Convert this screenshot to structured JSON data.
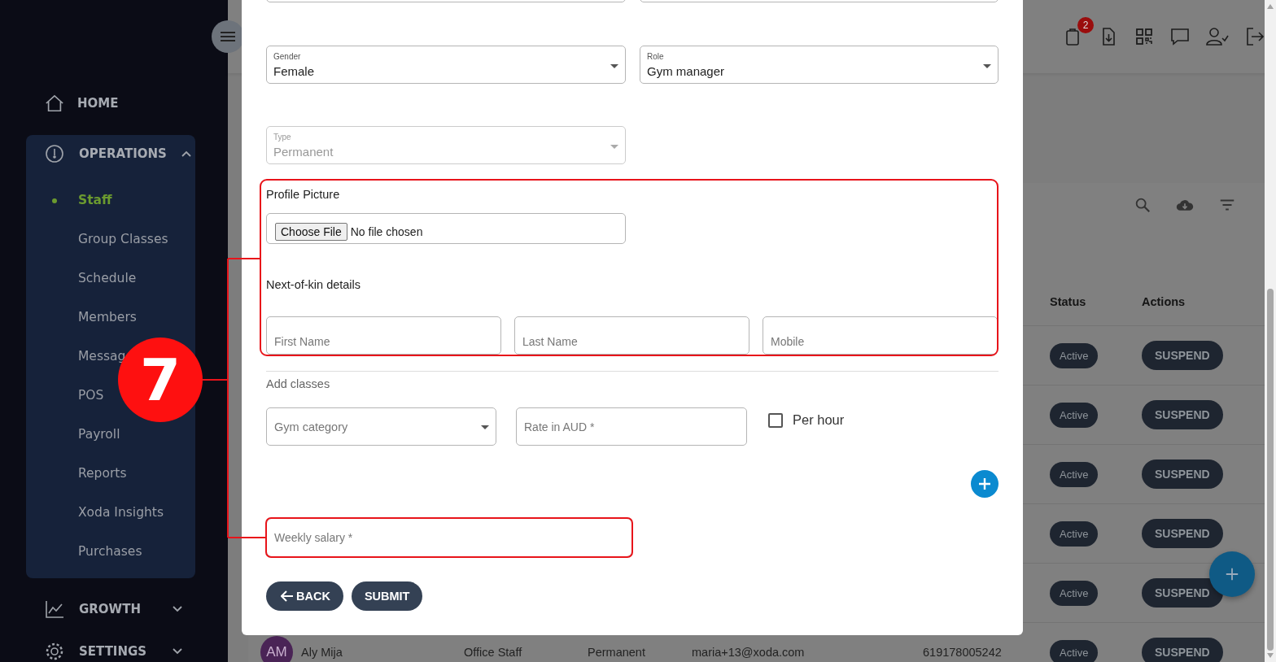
{
  "sidebar": {
    "home": {
      "label": "HOME"
    },
    "groups": [
      {
        "label": "OPERATIONS",
        "expanded": true,
        "children": [
          {
            "label": "Staff",
            "selected": true
          },
          {
            "label": "Group Classes",
            "selected": false
          },
          {
            "label": "Schedule",
            "selected": false
          },
          {
            "label": "Members",
            "selected": false
          },
          {
            "label": "Messag",
            "selected": false
          },
          {
            "label": "POS",
            "selected": false
          },
          {
            "label": "Payroll",
            "selected": false
          },
          {
            "label": "Reports",
            "selected": false
          },
          {
            "label": "Xoda Insights",
            "selected": false
          },
          {
            "label": "Purchases",
            "selected": false
          }
        ]
      },
      {
        "label": "GROWTH",
        "expanded": false
      },
      {
        "label": "SETTINGS",
        "expanded": false
      }
    ]
  },
  "header": {
    "notification_count": "2"
  },
  "table": {
    "columns": [
      "Status",
      "Actions"
    ],
    "rows": [
      {
        "status": "Active",
        "action": "SUSPEND"
      },
      {
        "status": "Active",
        "action": "SUSPEND"
      },
      {
        "status": "Active",
        "action": "SUSPEND"
      },
      {
        "status": "Active",
        "action": "SUSPEND"
      },
      {
        "status": "Active",
        "action": "SUSPEND"
      },
      {
        "avatar": "AM",
        "name": "Aly Mija",
        "role": "Office Staff",
        "type": "Permanent",
        "email": "maria+13@xoda.com",
        "mobile": "619178005242",
        "status": "Active",
        "action": "SUSPEND"
      }
    ]
  },
  "form": {
    "selects": [
      {
        "label": "Gender",
        "value": "Female",
        "disabled": false
      },
      {
        "label": "Role",
        "value": "Gym manager",
        "disabled": false
      },
      {
        "label": "Type",
        "value": "Permanent",
        "disabled": true
      }
    ],
    "profile_picture": {
      "label": "Profile Picture",
      "button": "Choose File",
      "status": "No file chosen"
    },
    "next_of_kin": {
      "title": "Next-of-kin details",
      "fields": [
        {
          "placeholder": "First Name"
        },
        {
          "placeholder": "Last Name"
        },
        {
          "placeholder": "Mobile"
        }
      ]
    },
    "add_classes": {
      "title": "Add classes",
      "category": {
        "placeholder": "Gym category"
      },
      "rate": {
        "placeholder": "Rate in AUD *"
      },
      "per_hour": {
        "label": "Per hour",
        "checked": false
      }
    },
    "weekly_salary": {
      "placeholder": "Weekly salary *"
    },
    "buttons": [
      {
        "label": "BACK"
      },
      {
        "label": "SUBMIT"
      }
    ]
  },
  "annotation": {
    "number": "7"
  }
}
